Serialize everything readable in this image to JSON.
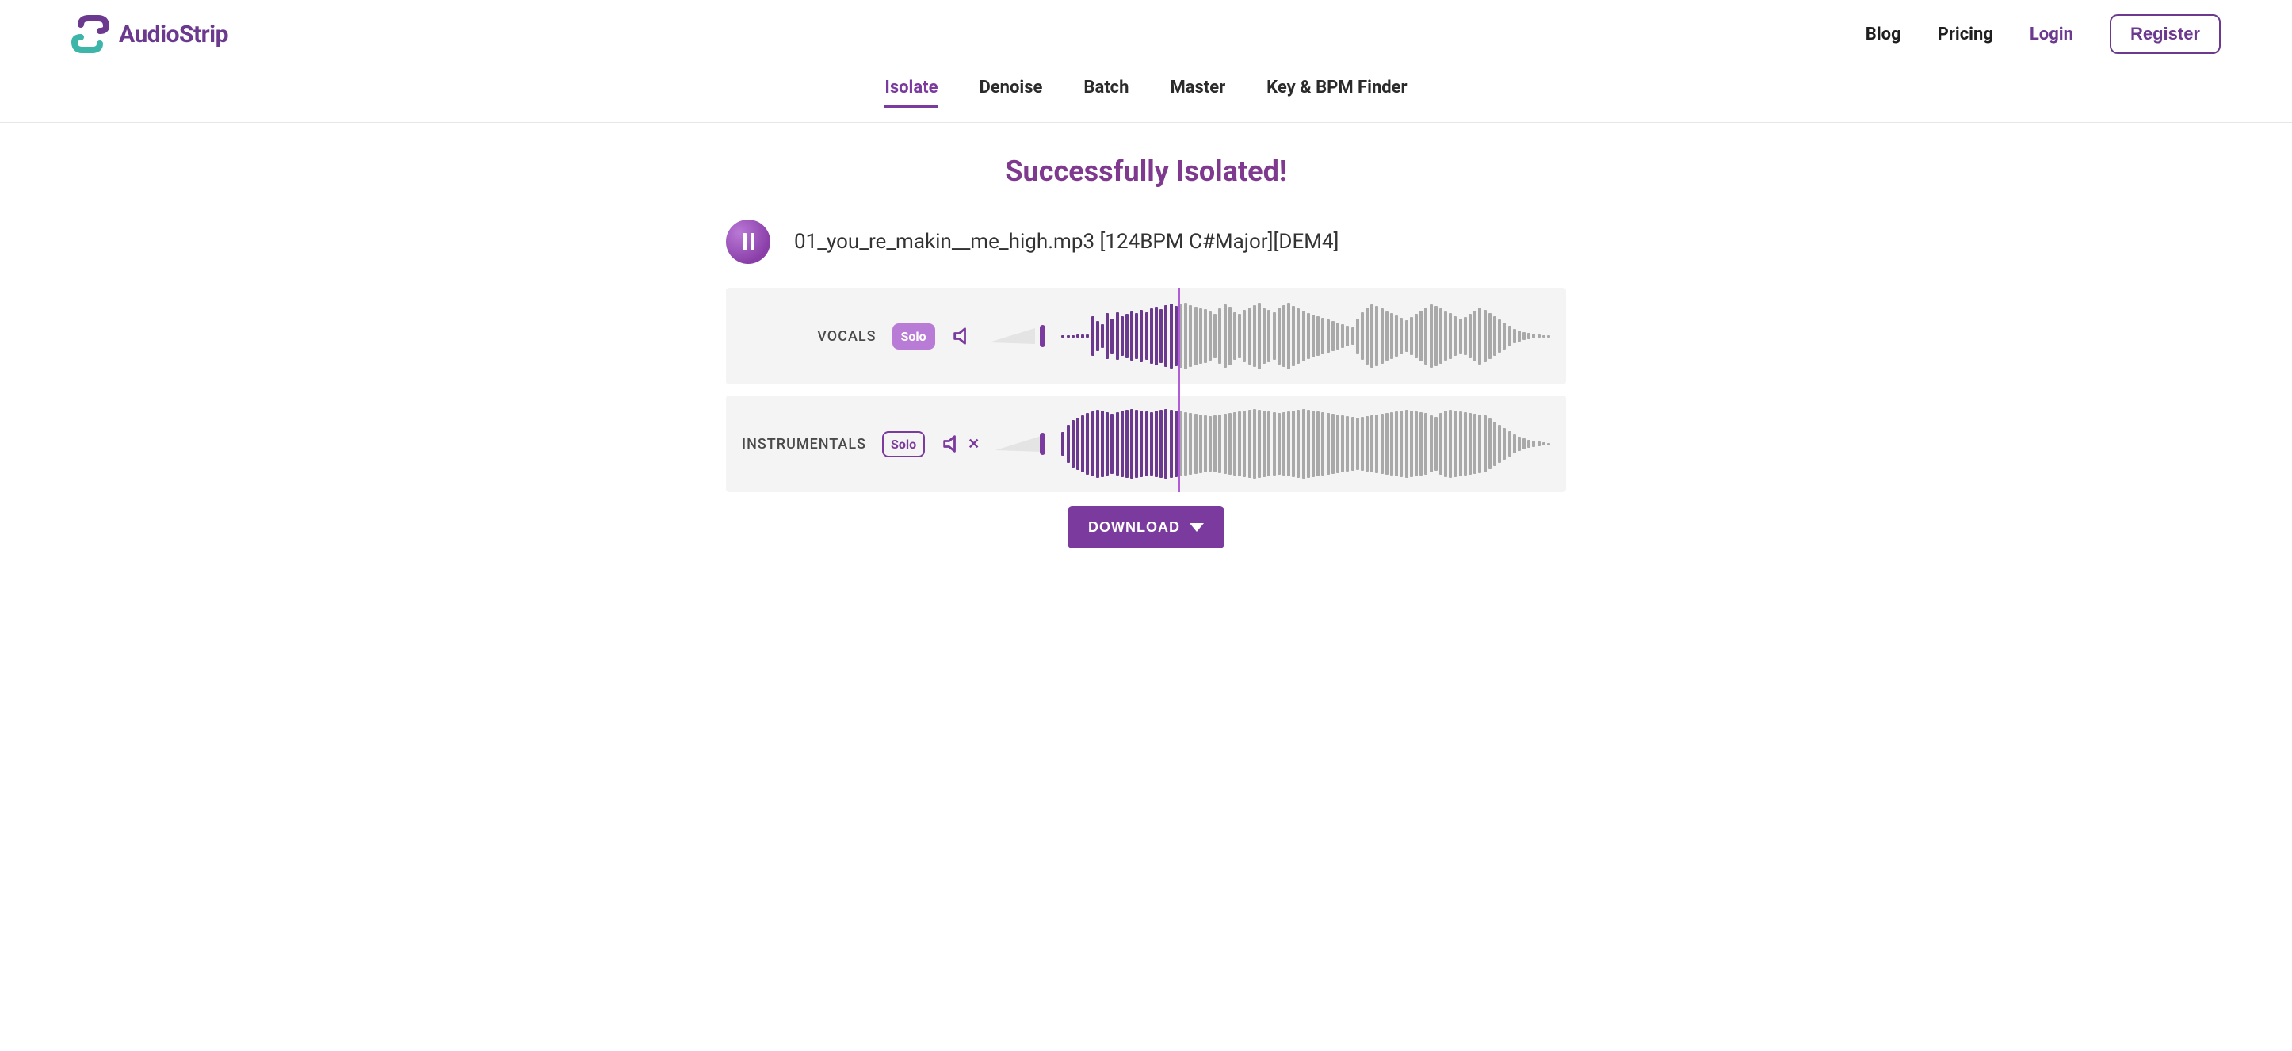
{
  "brand": {
    "name": "AudioStrip"
  },
  "topnav": {
    "blog": "Blog",
    "pricing": "Pricing",
    "login": "Login",
    "register": "Register"
  },
  "subnav": {
    "isolate": "Isolate",
    "denoise": "Denoise",
    "batch": "Batch",
    "master": "Master",
    "keybpm": "Key & BPM Finder"
  },
  "status_headline": "Successfully Isolated!",
  "track": {
    "filename": "01_you_re_makin__me_high.mp3 [124BPM C#Major][DEM4]"
  },
  "stems": {
    "vocals": {
      "label": "VOCALS",
      "solo_label": "Solo",
      "solo_on": true,
      "muted": false
    },
    "instrumentals": {
      "label": "INSTRUMENTALS",
      "solo_label": "Solo",
      "solo_on": false,
      "muted": true
    }
  },
  "playhead_fraction": 0.24,
  "download_label": "DOWNLOAD",
  "colors": {
    "accent": "#7b3a9d",
    "accent_light": "#b97cd6",
    "teal": "#3db5a8"
  },
  "vocals_wave": [
    3,
    3,
    3,
    4,
    5,
    4,
    50,
    38,
    30,
    58,
    44,
    60,
    50,
    56,
    62,
    58,
    66,
    60,
    70,
    74,
    68,
    78,
    82,
    76,
    80,
    84,
    78,
    74,
    70,
    68,
    62,
    56,
    70,
    80,
    74,
    60,
    56,
    66,
    72,
    78,
    84,
    70,
    66,
    60,
    72,
    78,
    84,
    76,
    70,
    64,
    58,
    54,
    50,
    46,
    42,
    38,
    34,
    30,
    26,
    22,
    44,
    60,
    72,
    80,
    76,
    70,
    62,
    58,
    52,
    46,
    40,
    48,
    56,
    64,
    72,
    80,
    76,
    70,
    62,
    58,
    50,
    44,
    48,
    56,
    64,
    72,
    66,
    58,
    50,
    42,
    34,
    26,
    18,
    14,
    10,
    8,
    6,
    4,
    3,
    3
  ],
  "instr_wave": [
    30,
    48,
    60,
    66,
    72,
    78,
    82,
    86,
    84,
    80,
    76,
    80,
    84,
    86,
    88,
    86,
    84,
    82,
    80,
    84,
    86,
    88,
    86,
    84,
    82,
    80,
    78,
    76,
    74,
    72,
    70,
    72,
    74,
    76,
    78,
    80,
    82,
    84,
    86,
    88,
    86,
    84,
    82,
    80,
    78,
    80,
    82,
    84,
    86,
    88,
    86,
    84,
    82,
    80,
    78,
    76,
    74,
    72,
    70,
    68,
    66,
    68,
    70,
    72,
    74,
    76,
    78,
    80,
    82,
    84,
    86,
    84,
    82,
    80,
    78,
    72,
    68,
    78,
    84,
    86,
    84,
    82,
    80,
    78,
    76,
    74,
    72,
    64,
    56,
    48,
    40,
    32,
    24,
    18,
    14,
    10,
    8,
    6,
    4,
    3
  ]
}
